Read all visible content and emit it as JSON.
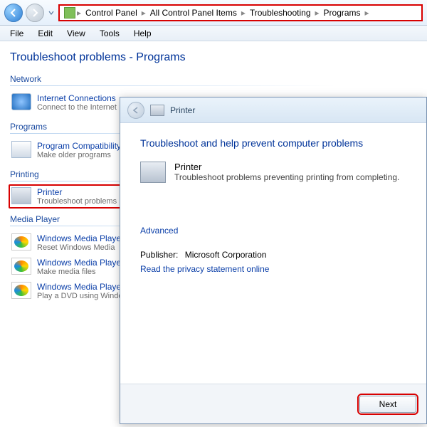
{
  "breadcrumb": {
    "items": [
      "Control Panel",
      "All Control Panel Items",
      "Troubleshooting",
      "Programs"
    ]
  },
  "menu": {
    "items": [
      "File",
      "Edit",
      "View",
      "Tools",
      "Help"
    ]
  },
  "page": {
    "title": "Troubleshoot problems - Programs"
  },
  "sections": [
    {
      "heading": "Network",
      "items": [
        {
          "title": "Internet Connections",
          "sub": "Connect to the Internet",
          "icon": "globe"
        }
      ]
    },
    {
      "heading": "Programs",
      "items": [
        {
          "title": "Program Compatibility",
          "sub": "Make older programs",
          "icon": "app"
        }
      ]
    },
    {
      "heading": "Printing",
      "items": [
        {
          "title": "Printer",
          "sub": "Troubleshoot problems",
          "icon": "printer",
          "highlight": true
        }
      ]
    },
    {
      "heading": "Media Player",
      "items": [
        {
          "title": "Windows Media Player",
          "sub": "Reset Windows Media",
          "icon": "wmp"
        },
        {
          "title": "Windows Media Player",
          "sub": "Make media files",
          "icon": "wmp"
        },
        {
          "title": "Windows Media Player",
          "sub": "Play a DVD using Windows",
          "icon": "wmp"
        }
      ]
    }
  ],
  "wizard": {
    "title": "Printer",
    "heading": "Troubleshoot and help prevent computer problems",
    "item_title": "Printer",
    "item_sub": "Troubleshoot problems preventing printing from completing.",
    "advanced": "Advanced",
    "publisher_label": "Publisher:",
    "publisher_value": "Microsoft Corporation",
    "privacy": "Read the privacy statement online",
    "next": "Next"
  }
}
